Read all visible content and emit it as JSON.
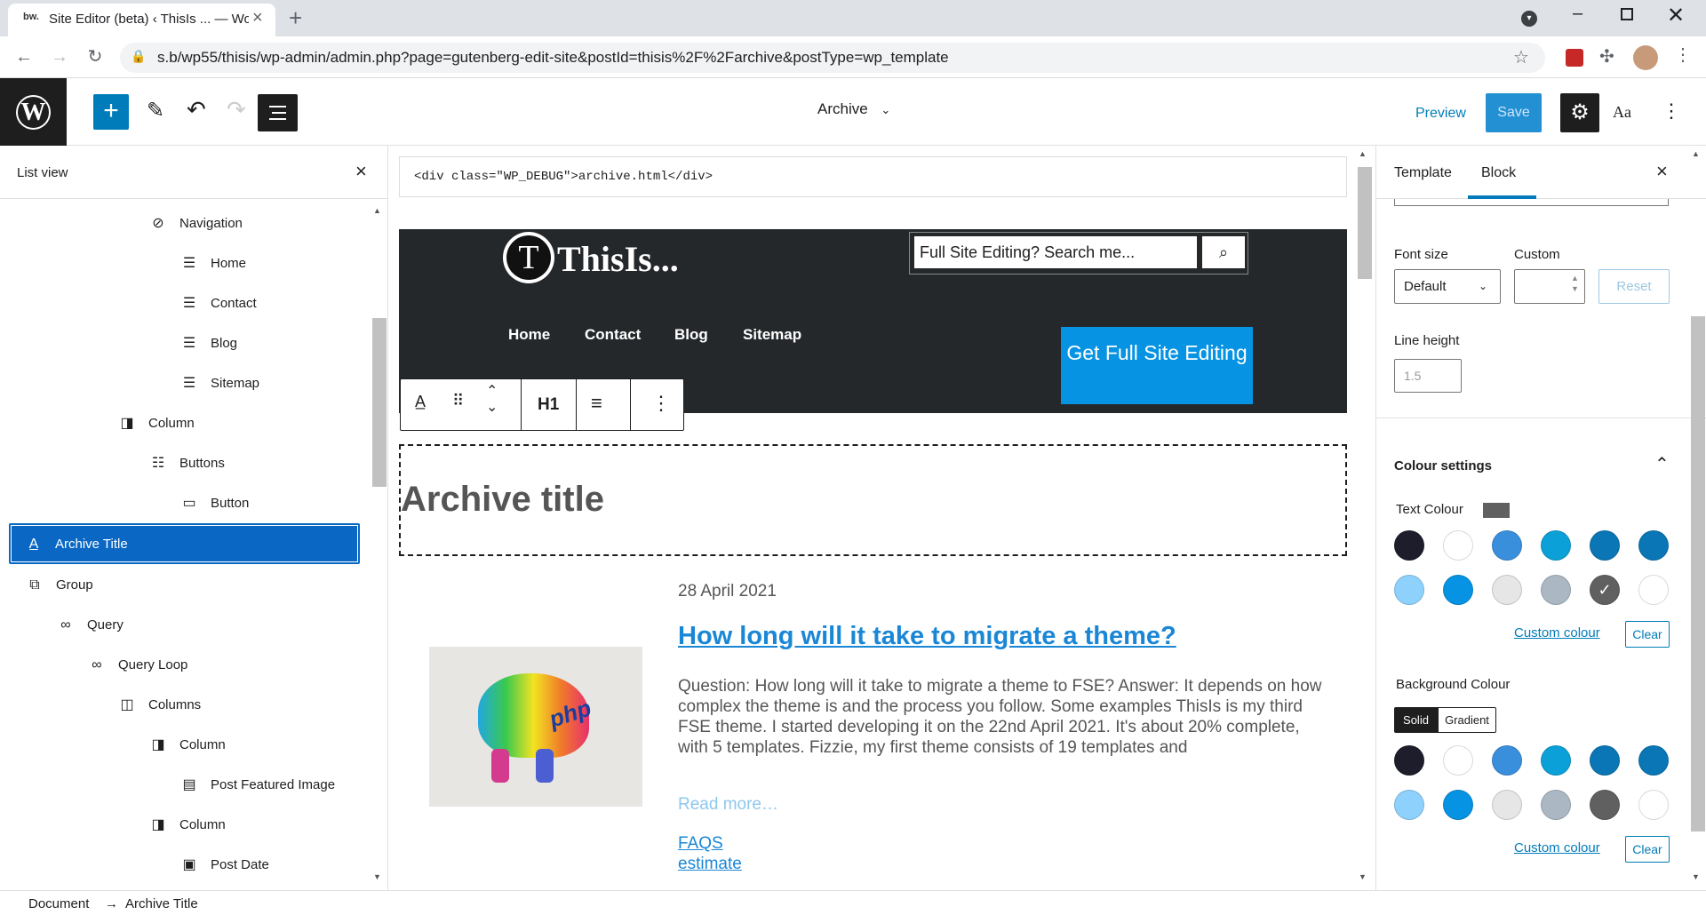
{
  "browser": {
    "tab_title": "Site Editor (beta) ‹ ThisIs ... — Wo",
    "url": "s.b/wp55/thisis/wp-admin/admin.php?page=gutenberg-edit-site&postId=thisis%2F%2Farchive&postType=wp_template"
  },
  "header": {
    "template_name": "Archive",
    "preview": "Preview",
    "save": "Save",
    "typography": "Aa"
  },
  "list_view": {
    "title": "List view",
    "items": [
      {
        "label": "Navigation",
        "icon": "navigation-icon"
      },
      {
        "label": "Home",
        "icon": "page-icon"
      },
      {
        "label": "Contact",
        "icon": "page-icon"
      },
      {
        "label": "Blog",
        "icon": "page-icon"
      },
      {
        "label": "Sitemap",
        "icon": "page-icon"
      },
      {
        "label": "Column",
        "icon": "column-icon"
      },
      {
        "label": "Buttons",
        "icon": "buttons-icon"
      },
      {
        "label": "Button",
        "icon": "button-icon"
      },
      {
        "label": "Archive Title",
        "icon": "title-icon"
      },
      {
        "label": "Group",
        "icon": "group-icon"
      },
      {
        "label": "Query",
        "icon": "loop-icon"
      },
      {
        "label": "Query Loop",
        "icon": "loop-icon"
      },
      {
        "label": "Columns",
        "icon": "columns-icon"
      },
      {
        "label": "Column",
        "icon": "column-icon"
      },
      {
        "label": "Post Featured Image",
        "icon": "image-icon"
      },
      {
        "label": "Column",
        "icon": "column-icon"
      },
      {
        "label": "Post Date",
        "icon": "date-icon"
      }
    ]
  },
  "canvas": {
    "debug": "<div class=\"WP_DEBUG\">archive.html</div>",
    "site_title": "ThisIs...",
    "search_placeholder": "Full Site Editing? Search me...",
    "nav": [
      "Home",
      "Contact",
      "Blog",
      "Sitemap"
    ],
    "cta": "Get Full Site Editing",
    "toolbar_heading": "H1",
    "archive_title": "Archive title",
    "post": {
      "date": "28 April 2021",
      "title": "How long will it take to migrate a theme?",
      "excerpt": "Question: How long will it take to migrate a theme to FSE? Answer: It depends on how complex the theme is and the process you follow. Some examples ThisIs is my third FSE theme. I started developing it on the 22nd April 2021. It's about 20% complete, with 5 templates. Fizzie, my first theme consists of 19 templates and",
      "read_more": "Read more…",
      "tags": [
        "FAQS",
        "estimate"
      ],
      "image_text": "php"
    }
  },
  "sidebar": {
    "tab_template": "Template",
    "tab_block": "Block",
    "font_size_label": "Font size",
    "custom_label": "Custom",
    "font_size_value": "Default",
    "reset": "Reset",
    "line_height_label": "Line height",
    "line_height_placeholder": "1.5",
    "colour_settings": "Colour settings",
    "text_colour": "Text Colour",
    "custom_colour": "Custom colour",
    "clear": "Clear",
    "background_colour": "Background Colour",
    "solid": "Solid",
    "gradient": "Gradient"
  },
  "footer": {
    "crumb_document": "Document",
    "crumb_arrow": "→",
    "crumb_current": "Archive Title"
  },
  "colors": {
    "accent": "#007cba",
    "header_bg": "#25282b",
    "cta_bg": "#0693e3",
    "selected_item": "#0a68c4",
    "palette": [
      "#1d1d2c",
      "#ffffff",
      "#3a8fdc",
      "#0ca0d8",
      "#0a76b5",
      "#0a76b5",
      "#8ed1fc",
      "#0693e3",
      "#e6e6e6",
      "#abb8c3",
      "#606060",
      "#ffffff"
    ]
  }
}
